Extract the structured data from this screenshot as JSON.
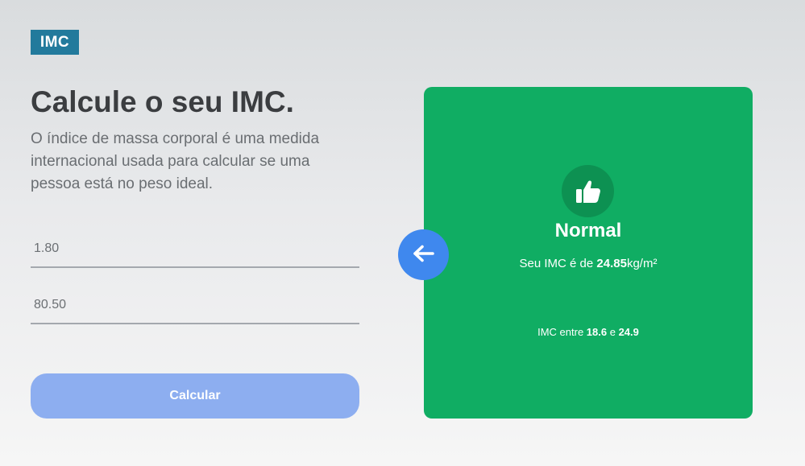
{
  "logo": {
    "text": "IMC"
  },
  "header": {
    "title": "Calcule o seu IMC.",
    "description": "O índice de massa corporal é uma medida internacional usada para calcular se uma pessoa está no peso ideal."
  },
  "form": {
    "height_value": "1.80",
    "weight_value": "80.50",
    "calculate_label": "Calcular"
  },
  "result": {
    "status": "Normal",
    "imc_prefix": "Seu IMC é de ",
    "imc_value": "24.85",
    "imc_unit": "kg/m²",
    "range_prefix": "IMC entre ",
    "range_min": "18.6",
    "range_joiner": " e ",
    "range_max": "24.9",
    "icon": "thumbs-up-icon"
  },
  "back_button": {
    "icon": "arrow-left-icon"
  },
  "colors": {
    "logo_bg": "#227a9c",
    "card_bg": "#10ad63",
    "icon_circle_bg": "#0d9152",
    "button_bg": "#8daef0",
    "back_button_bg": "#3f88ee"
  }
}
